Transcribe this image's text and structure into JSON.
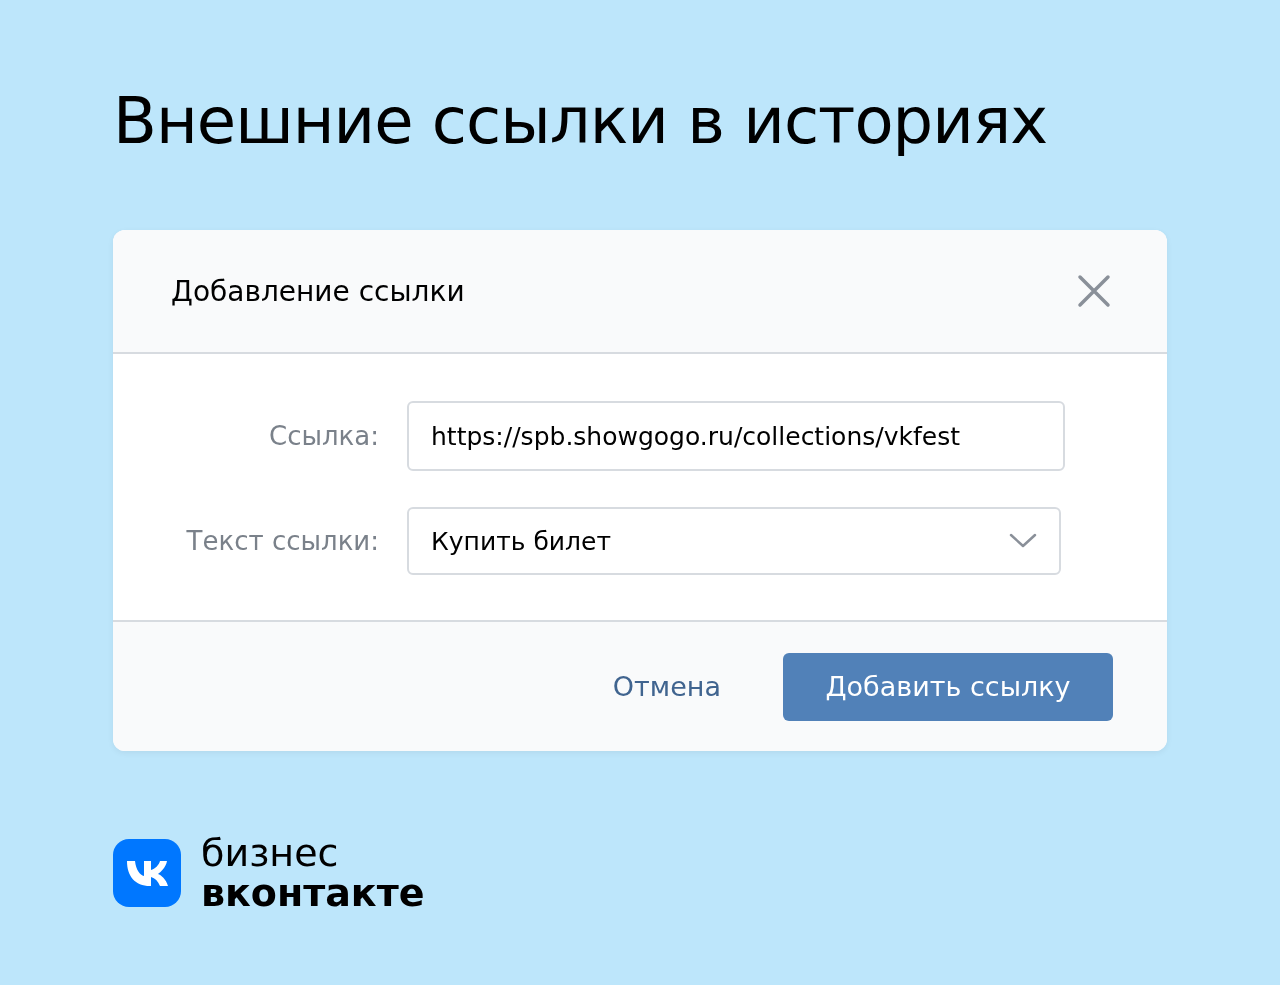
{
  "headline": "Внешние ссылки в историях",
  "dialog": {
    "title": "Добавление ссылки",
    "fields": [
      {
        "label": "Ссылка:",
        "value": "https://spb.showgogo.ru/collections/vkfest",
        "kind": "text"
      },
      {
        "label": "Текст ссылки:",
        "value": "Купить билет",
        "kind": "select"
      }
    ],
    "cancel": "Отмена",
    "submit": "Добавить ссылку"
  },
  "brand": {
    "line1": "бизнес",
    "line2": "вконтакте"
  }
}
